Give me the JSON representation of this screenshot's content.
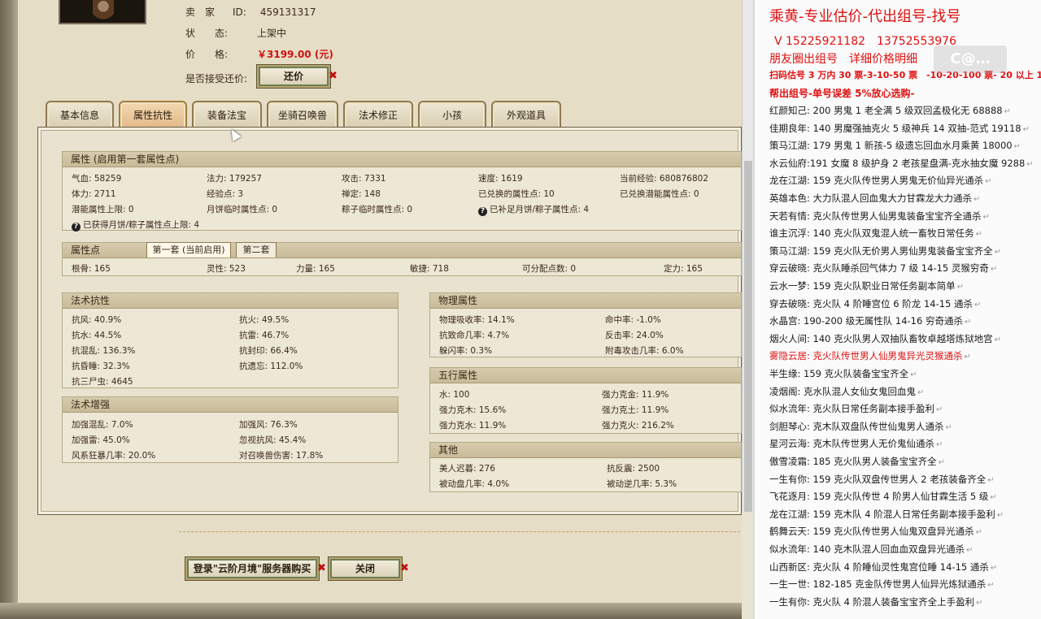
{
  "listing": {
    "seller_label": "卖　家",
    "id_label": "ID:",
    "id_value": "459131317",
    "status_label": "状　　态:",
    "status_value": "上架中",
    "price_label": "价　　格:",
    "price_value": "￥3199.00 (元)",
    "counter_label": "是否接受还价:",
    "counter_button": "还价"
  },
  "tabs": [
    {
      "label": "基本信息",
      "active": false
    },
    {
      "label": "属性抗性",
      "active": true
    },
    {
      "label": "装备法宝",
      "active": false
    },
    {
      "label": "坐骑召唤兽",
      "active": false
    },
    {
      "label": "法术修正",
      "active": false
    },
    {
      "label": "小孩",
      "active": false
    },
    {
      "label": "外观道具",
      "active": false
    }
  ],
  "attributes": {
    "title": "属性 (启用第一套属性点)",
    "rows": [
      [
        "气血: 58259",
        "法力: 179257",
        "攻击: 7331",
        "速度: 1619",
        "当前经验: 680876802"
      ],
      [
        "体力: 2711",
        "经验点: 3",
        "禅定: 148",
        "已兑换的属性点: 10",
        "已兑换潜能属性点: 0"
      ],
      [
        "潜能属性上限: 0",
        "月饼临时属性点: 0",
        "粽子临时属性点: 0",
        "已补足月饼/粽子属性点: 4",
        ""
      ]
    ],
    "note": "已获得月饼/粽子属性点上限: 4"
  },
  "points": {
    "title": "属性点",
    "tab1": "第一套 (当前启用)",
    "tab2": "第二套",
    "values": [
      "根骨: 165",
      "灵性: 523",
      "力量: 165",
      "敏捷: 718",
      "可分配点数: 0",
      "定力: 165"
    ]
  },
  "magic_resist": {
    "title": "法术抗性",
    "cells": [
      "抗风: 40.9%",
      "抗火: 49.5%",
      "抗水: 44.5%",
      "抗雷: 46.7%",
      "抗混乱: 136.3%",
      "抗封印: 66.4%",
      "抗昏睡: 32.3%",
      "抗遗忘: 112.0%",
      "抗三尸虫: 4645",
      ""
    ]
  },
  "magic_boost": {
    "title": "法术增强",
    "cells": [
      "加强混乱: 7.0%",
      "加强风: 76.3%",
      "加强雷: 45.0%",
      "忽视抗风: 45.4%",
      "风系狂暴几率: 20.0%",
      "对召唤兽伤害: 17.8%"
    ]
  },
  "physical": {
    "title": "物理属性",
    "cells": [
      "物理吸收率: 14.1%",
      "命中率: -1.0%",
      "抗致命几率: 4.7%",
      "反击率: 24.0%",
      "躲闪率: 0.3%",
      "附毒攻击几率: 6.0%"
    ]
  },
  "elements": {
    "title": "五行属性",
    "cells": [
      "水: 100",
      "强力克金: 11.9%",
      "强力克木: 15.6%",
      "强力克土: 11.9%",
      "强力克水: 11.9%",
      "强力克火: 216.2%"
    ]
  },
  "other": {
    "title": "其他",
    "cells": [
      "美人迟暮: 276",
      "抗反震: 2500",
      "被动盘几率: 4.0%",
      "被动逆几率: 5.3%"
    ]
  },
  "footer": {
    "login_button": "登录\"云阶月境\"服务器购买",
    "close_button": "关闭"
  },
  "ad": {
    "title": "乘黄-专业估价-代出组号-找号",
    "contact": "V 15225921182　13752553976",
    "line1": "朋友圈出组号　详细价格明细",
    "line2": "扫码估号 3 万内 30 票-3-10-50 票　-10-20-100 票- 20 以上 150",
    "line3": "帮出组号-单号误差 5%放心选购-",
    "items": [
      {
        "text": "红颜知己: 200 男鬼 1 老全满 5 级双回孟极化无 68888",
        "hl": false
      },
      {
        "text": "佳期良年: 140 男魔强抽克火 5 级神兵 14 双抽-范式 19118",
        "hl": false
      },
      {
        "text": "策马江湖: 179 男鬼 1 新孩-5 级遗忘回血水月乘黄 18000",
        "hl": false
      },
      {
        "text": "水云仙府:191 女魔 8 级护身 2 老孩星盘满-克水抽女魔 9288",
        "hl": false
      },
      {
        "text": "龙在江湖: 159 克火队传世男人男鬼无价仙异光通杀",
        "hl": false
      },
      {
        "text": "英雄本色: 大力队混人回血鬼大力甘霖龙大力通杀",
        "hl": false
      },
      {
        "text": "天若有情: 克火队传世男人仙男鬼装备宝宝齐全通杀",
        "hl": false
      },
      {
        "text": "谁主沉浮: 140 克火队双鬼混人统一畜牧日常任务",
        "hl": false
      },
      {
        "text": "策马江湖: 159 克火队无价男人男仙男鬼装备宝宝齐全",
        "hl": false
      },
      {
        "text": "穿云破晓: 克火队睡杀回气体力 7 级 14-15 灵猴穷奇",
        "hl": false
      },
      {
        "text": "云水一梦: 159 克火队职业日常任务副本简单",
        "hl": false
      },
      {
        "text": "穿去破晓: 克火队 4 阶睡宫位 6 阶龙 14-15 通杀",
        "hl": false
      },
      {
        "text": "水晶宫: 190-200 级无属性队 14-16 穷奇通杀",
        "hl": false
      },
      {
        "text": "烟火人间: 140 克火队男人双抽队畜牧卓越塔炼狱地宫",
        "hl": false
      },
      {
        "text": "雾隐云居: 克火队传世男人仙男鬼异光灵猴通杀",
        "hl": true
      },
      {
        "text": "半生缘: 159 克火队装备宝宝齐全",
        "hl": false
      },
      {
        "text": "凌烟阁: 克水队混人女仙女鬼回血鬼",
        "hl": false
      },
      {
        "text": "似水流年: 克火队日常任务副本接手盈利",
        "hl": false
      },
      {
        "text": "剑胆琴心: 克木队双盘队传世仙鬼男人通杀",
        "hl": false
      },
      {
        "text": "星河云海: 克木队传世男人无价鬼仙通杀",
        "hl": false
      },
      {
        "text": "傲雪凌霜: 185 克火队男人装备宝宝齐全",
        "hl": false
      },
      {
        "text": "一生有你: 159 克火队双盘传世男人 2 老孩装备齐全",
        "hl": false
      },
      {
        "text": "飞花逐月: 159 克火队传世 4 阶男人仙甘霖生活 5 级",
        "hl": false
      },
      {
        "text": "龙在江湖: 159 克木队 4 阶混人日常任务副本接手盈利",
        "hl": false
      },
      {
        "text": "鹤舞云天: 159 克火队传世男人仙鬼双盘异光通杀",
        "hl": false
      },
      {
        "text": "似水流年: 140 克木队混人回血血双盘异光通杀",
        "hl": false
      },
      {
        "text": "山西新区: 克火队 4 阶睡仙灵性鬼宫位睡 14-15 通杀",
        "hl": false
      },
      {
        "text": "一生一世: 182-185 克金队传世男人仙异光炼狱通杀",
        "hl": false
      },
      {
        "text": "一生有你: 克火队 4 阶混人装备宝宝齐全上手盈利",
        "hl": false
      }
    ]
  }
}
